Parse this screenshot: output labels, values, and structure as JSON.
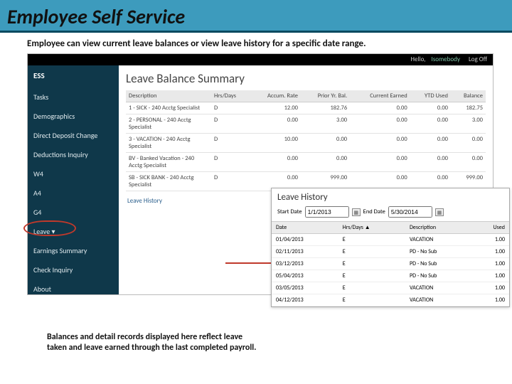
{
  "slide": {
    "title": "Employee Self Service",
    "subtitle": "Employee can view current leave balances or view leave history for a specific date range.",
    "note": "Balances and detail records displayed here reflect leave taken and leave earned through the last completed payroll."
  },
  "topbar": {
    "hello": "Hello,",
    "user": "Isomebody",
    "logoff": "Log Off"
  },
  "sidebar": {
    "logo": "ESS",
    "items": [
      "Tasks",
      "Demographics",
      "Direct Deposit Change",
      "Deductions Inquiry",
      "W4",
      "A4",
      "G4",
      "Leave ▾",
      "Earnings Summary",
      "Check Inquiry",
      "About",
      "—"
    ]
  },
  "summary": {
    "title": "Leave Balance Summary",
    "cols": [
      "Description",
      "Hrs/Days",
      "Accum. Rate",
      "Prior Yr. Bal.",
      "Current Earned",
      "YTD Used",
      "Balance"
    ],
    "rows": [
      {
        "desc": "1 - SICK - 240 Acctg Specialist",
        "hd": "D",
        "rate": "12.00",
        "prior": "182.76",
        "earned": "0.00",
        "used": "0.00",
        "bal": "182.75"
      },
      {
        "desc": "2 - PERSONAL - 240 Acctg Specialist",
        "hd": "D",
        "rate": "0.00",
        "prior": "3.00",
        "earned": "0.00",
        "used": "0.00",
        "bal": "3.00"
      },
      {
        "desc": "3 - VACATION - 240 Acctg Specialist",
        "hd": "D",
        "rate": "10.00",
        "prior": "0.00",
        "earned": "0.00",
        "used": "0.00",
        "bal": "0.00"
      },
      {
        "desc": "BV - Banked Vacation - 240 Acctg Specialist",
        "hd": "D",
        "rate": "0.00",
        "prior": "0.00",
        "earned": "0.00",
        "used": "0.00",
        "bal": "0.00"
      },
      {
        "desc": "SB - SICK BANK - 240 Acctg Specialist",
        "hd": "D",
        "rate": "0.00",
        "prior": "999.00",
        "earned": "0.00",
        "used": "0.00",
        "bal": "999.00"
      }
    ],
    "link": "Leave History"
  },
  "history": {
    "title": "Leave History",
    "start_label": "Start Date",
    "start_val": "1/1/2013",
    "end_label": "End Date",
    "end_val": "5/30/2014",
    "cols": [
      "Date",
      "Hrs/Days ▲",
      "Description",
      "Used"
    ],
    "rows": [
      {
        "d": "01/04/2013",
        "hd": "E",
        "desc": "VACATION",
        "u": "1.00"
      },
      {
        "d": "02/11/2013",
        "hd": "E",
        "desc": "PD - No Sub",
        "u": "1.00"
      },
      {
        "d": "03/12/2013",
        "hd": "E",
        "desc": "PD - No Sub",
        "u": "1.00"
      },
      {
        "d": "05/04/2013",
        "hd": "E",
        "desc": "PD - No Sub",
        "u": "1.00"
      },
      {
        "d": "03/05/2013",
        "hd": "E",
        "desc": "VACATION",
        "u": "1.00"
      },
      {
        "d": "04/12/2013",
        "hd": "E",
        "desc": "VACATION",
        "u": "1.00"
      }
    ]
  }
}
